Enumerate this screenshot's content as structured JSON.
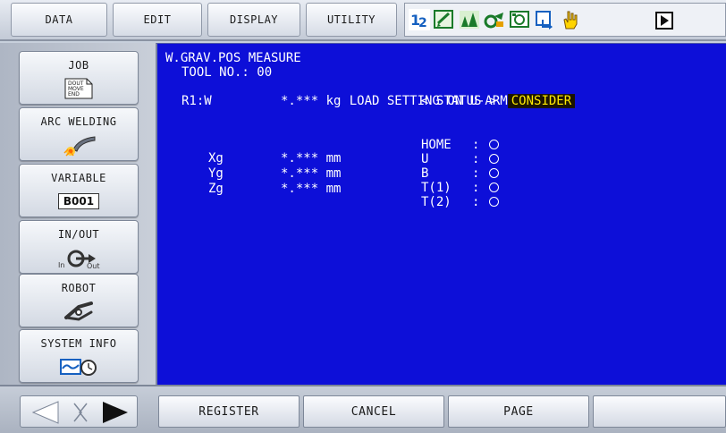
{
  "menu": {
    "data": "DATA",
    "edit": "EDIT",
    "display": "DISPLAY",
    "utility": "UTILITY"
  },
  "status_icons": [
    "axis-12-icon",
    "edit-lock-icon",
    "play-mode-icon",
    "machine-icon",
    "cycle-icon",
    "servo-icon",
    "hand-icon",
    "play-icon"
  ],
  "sidebar": {
    "job": {
      "label": "JOB",
      "icon_text": [
        "DOUT",
        "MOVE",
        "END"
      ]
    },
    "arc_welding": {
      "label": "ARC WELDING"
    },
    "variable": {
      "label": "VARIABLE",
      "icon_text": "B001"
    },
    "inout": {
      "label": "IN/OUT",
      "in": "In",
      "out": "Out"
    },
    "robot": {
      "label": "ROBOT"
    },
    "system_info": {
      "label": "SYSTEM INFO"
    }
  },
  "screen": {
    "title": "W.GRAV.POS MEASURE",
    "tool_no": "TOOL NO.: 00",
    "load_setting_label": "LOAD SETTING ON U-ARM",
    "load_setting_value": "CONSIDER",
    "r1w_label": "R1:W",
    "r1w_value": "*.*** kg",
    "status_header": "< STATUS >",
    "coords": [
      {
        "label": "Xg",
        "value": "*.*** mm"
      },
      {
        "label": "Yg",
        "value": "*.*** mm"
      },
      {
        "label": "Zg",
        "value": "*.*** mm"
      }
    ],
    "status": [
      {
        "label": "HOME",
        "sep": ":"
      },
      {
        "label": "U",
        "sep": ":"
      },
      {
        "label": "B",
        "sep": ":"
      },
      {
        "label": "T(1)",
        "sep": ":"
      },
      {
        "label": "T(2)",
        "sep": ":"
      }
    ]
  },
  "function_keys": {
    "register": "REGISTER",
    "cancel": "CANCEL",
    "page": "PAGE",
    "empty": ""
  },
  "colors": {
    "panel_bg": "#0d0fd8",
    "highlight_bg": "#1b1400",
    "highlight_fg": "#ffea00"
  }
}
